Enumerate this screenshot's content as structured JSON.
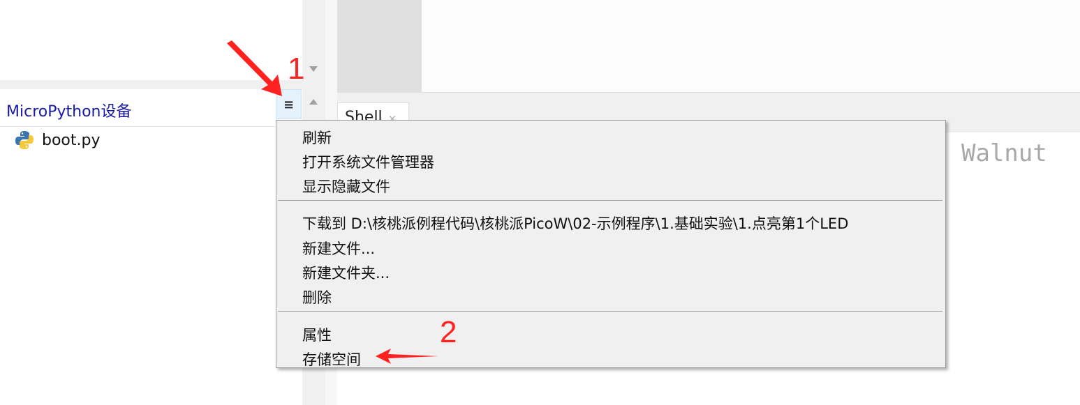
{
  "file_panel": {
    "title": "MicroPython设备",
    "menu_button": "≡",
    "files": [
      {
        "name": "boot.py",
        "icon": "python-file-icon"
      }
    ]
  },
  "tabs": [
    {
      "label": "Shell",
      "close": "×"
    }
  ],
  "shell": {
    "text": "Walnut"
  },
  "context_menu": {
    "groups": [
      [
        "刷新",
        "打开系统文件管理器",
        "显示隐藏文件"
      ],
      [
        "下载到 D:\\核桃派例程代码\\核桃派PicoW\\02-示例程序\\1.基础实验\\1.点亮第1个LED",
        "新建文件...",
        "新建文件夹...",
        "删除"
      ],
      [
        "属性",
        "存储空间"
      ]
    ]
  },
  "annotations": {
    "step1": "1",
    "step2": "2",
    "color": "#ff2020"
  }
}
